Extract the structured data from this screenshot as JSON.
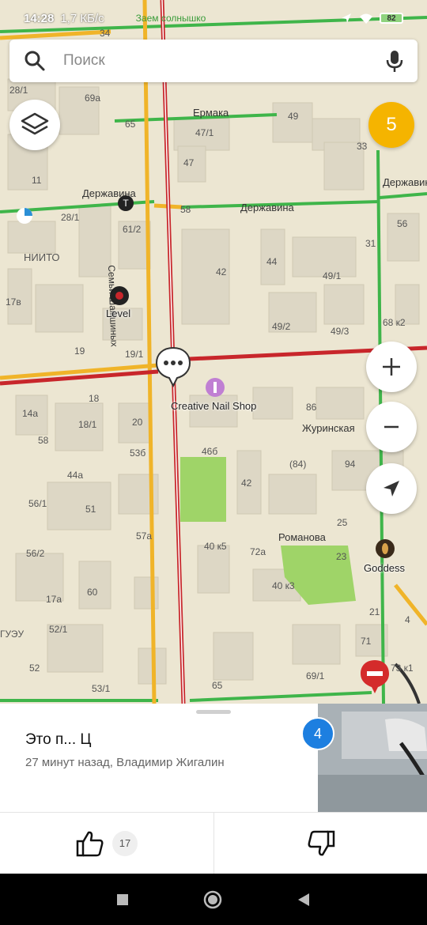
{
  "status_bar": {
    "time": "14:28",
    "speed": "1,7 КБ/с",
    "battery": "82"
  },
  "search": {
    "placeholder": "Поиск"
  },
  "map": {
    "traffic_level": "5",
    "streets": [
      "Ермака",
      "Державина",
      "Державина",
      "Державина",
      "Семьи Шамшиных",
      "Журинская",
      "Романова"
    ],
    "pois": [
      "Level",
      "Creative Nail Shop",
      "Goddess",
      "Заем солнышко",
      "НИИТО"
    ],
    "house_numbers": [
      "28/1",
      "34",
      "69а",
      "65",
      "49",
      "47/1",
      "47",
      "33",
      "11",
      "28/1",
      "61/2",
      "58",
      "56",
      "31",
      "44",
      "42",
      "49/1",
      "17в",
      "19",
      "19/1",
      "49/2",
      "49/3",
      "68 к2",
      "14а",
      "18",
      "18/1",
      "20",
      "86",
      "58",
      "53б",
      "46б",
      "(84)",
      "94",
      "44а",
      "42",
      "51",
      "56/1",
      "25",
      "57а",
      "40 к5",
      "72а",
      "23",
      "56/2",
      "17а",
      "60",
      "40 к3",
      "21",
      "4",
      "ГУЭУ",
      "52/1",
      "71",
      "52",
      "53/1",
      "65",
      "69/1",
      "73 к1",
      "4"
    ]
  },
  "event_card": {
    "title": "Это п... Ц",
    "meta": "27 минут назад, Владимир Жигалин",
    "photo_count": "4",
    "likes": "17"
  },
  "colors": {
    "accent_blue": "#1d7fe0",
    "traffic_yellow": "#f5b400",
    "road_red": "#c8262b",
    "road_green": "#3fb54a"
  }
}
